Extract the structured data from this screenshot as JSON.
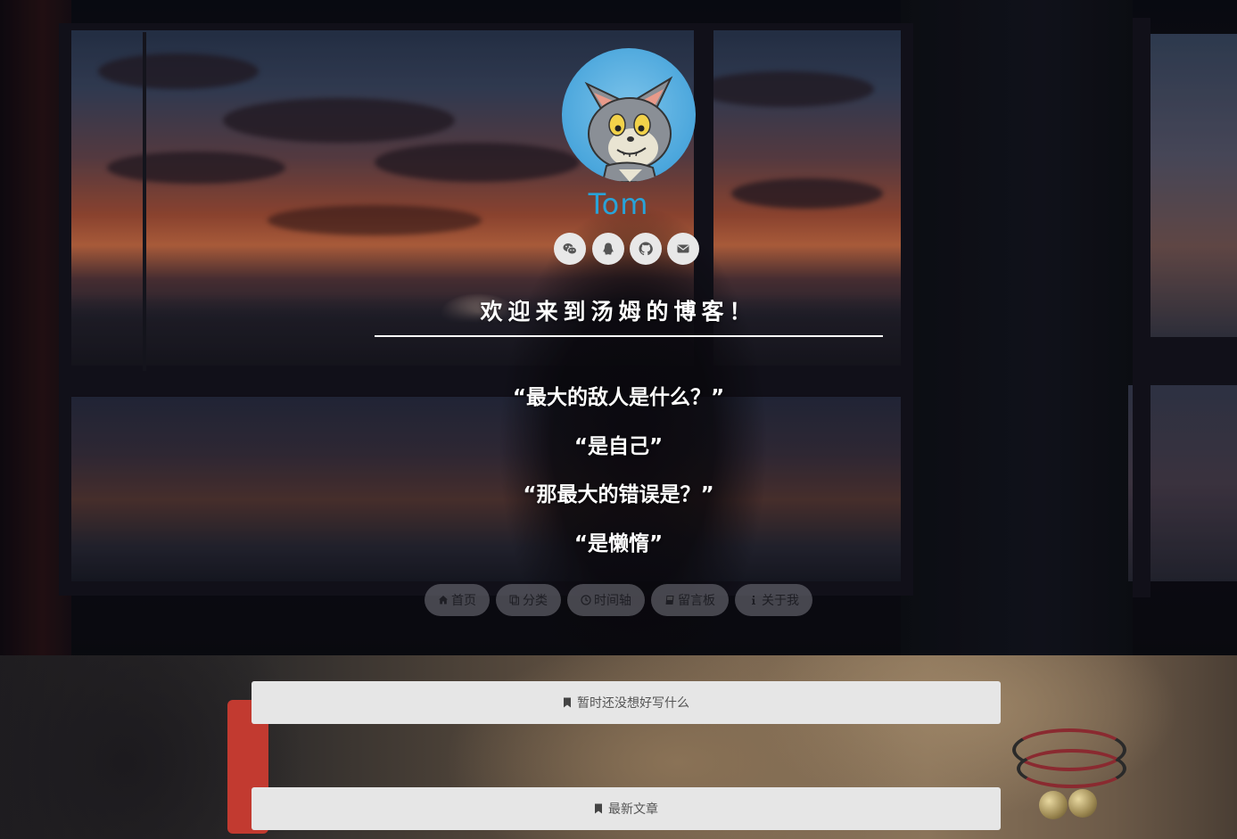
{
  "profile": {
    "name": "Tom",
    "avatar_icon": "tom-cat-avatar",
    "accent_color": "#29a3d8"
  },
  "socials": [
    {
      "icon": "wechat-icon"
    },
    {
      "icon": "qq-icon"
    },
    {
      "icon": "github-icon"
    },
    {
      "icon": "mail-icon"
    }
  ],
  "welcome": "欢迎来到汤姆的博客！",
  "quotes": [
    "“最大的敌人是什么？”",
    "“是自己”",
    "“那最大的错误是？”",
    "“是懒惰”"
  ],
  "nav": [
    {
      "label": "首页",
      "icon": "home-icon"
    },
    {
      "label": "分类",
      "icon": "copy-icon"
    },
    {
      "label": "时间轴",
      "icon": "clock-icon"
    },
    {
      "label": "留言板",
      "icon": "book-icon"
    },
    {
      "label": "关于我",
      "icon": "info-icon"
    }
  ],
  "cards": [
    {
      "label": "暂时还没想好写什么",
      "icon": "bookmark-icon"
    },
    {
      "label": "最新文章",
      "icon": "bookmark-icon"
    }
  ]
}
